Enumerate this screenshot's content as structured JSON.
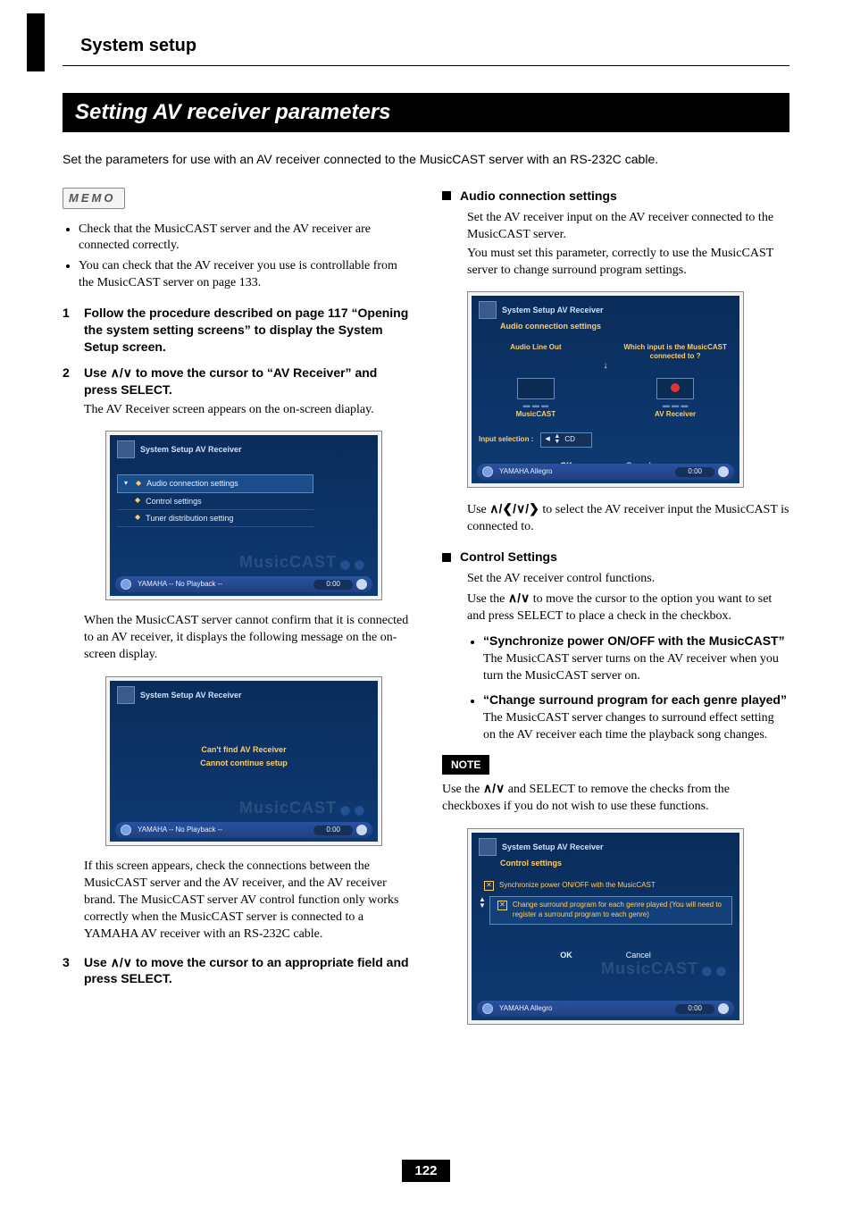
{
  "header": {
    "section": "System setup",
    "title": "Setting AV receiver parameters",
    "intro": "Set the parameters for use with an AV receiver connected to the MusicCAST server with an RS-232C cable."
  },
  "memo": {
    "label": "MEMO",
    "items": [
      "Check that the MusicCAST server and the AV receiver are connected correctly.",
      "You can check that the AV receiver you use is controllable from the MusicCAST server on page 133."
    ]
  },
  "steps": {
    "s1": {
      "num": "1",
      "title": "Follow the procedure described on page 117 “Opening the system setting screens” to display the System Setup screen."
    },
    "s2": {
      "num": "2",
      "title_a": "Use ",
      "title_b": " to move the cursor to “AV Receiver” and press SELECT.",
      "arrows": "∧/∨",
      "desc": "The AV Receiver screen appears on the on-screen diaplay."
    },
    "s3": {
      "num": "3",
      "title_a": "Use ",
      "title_b": " to move the cursor to an appropriate field and press SELECT.",
      "arrows": "∧/∨"
    }
  },
  "screen1": {
    "breadcrumb": "System Setup   AV Receiver",
    "items": [
      "Audio connection settings",
      "Control settings",
      "Tuner distribution setting"
    ],
    "watermark": "MusicCAST",
    "status_left": "YAMAHA  -- No Playback --",
    "status_time": "0:00"
  },
  "between12": "When the MusicCAST server cannot confirm that it is connected to an AV receiver, it displays the following message on the on-screen display.",
  "screen2": {
    "breadcrumb": "System Setup   AV Receiver",
    "msg1": "Can't find AV Receiver",
    "msg2": "Cannot continue setup",
    "watermark": "MusicCAST",
    "status_left": "YAMAHA  -- No Playback --",
    "status_time": "0:00"
  },
  "after2": "If this screen appears, check the connections between the MusicCAST server and the AV receiver, and the AV receiver brand. The MusicCAST server AV control function only works correctly when the MusicCAST server is connected to a YAMAHA AV receiver with an RS-232C cable.",
  "right": {
    "acs": {
      "title": "Audio connection settings",
      "p1": "Set the AV receiver input on the AV receiver connected to the MusicCAST server.",
      "p2": "You must set this parameter, correctly to use the MusicCAST server to change surround program settings.",
      "after_a": "Use ",
      "after_arrows": "∧/❮/∨/❯",
      "after_b": " to select the AV receiver input the MusicCAST is connected to."
    },
    "screen3": {
      "breadcrumb": "System Setup   AV Receiver",
      "subtitle": "Audio connection settings",
      "lineout": "Audio Line Out",
      "question": "Which input is the MusicCAST connected to ?",
      "dev1": "MusicCAST",
      "dev2": "AV Receiver",
      "inputsel": "Input selection :",
      "inputval": "CD",
      "ok": "OK",
      "cancel": "Cancel",
      "status_left": "YAMAHA  Allegro",
      "status_time": "0:00",
      "watermark": "MusicCAST"
    },
    "cs": {
      "title": "Control Settings",
      "p1": "Set the AV receiver control functions.",
      "p2_a": "Use the ",
      "p2_arrows": "∧/∨",
      "p2_b": " to move the cursor to the option you want to set and press SELECT to place a check in the checkbox.",
      "b1_title": "“Synchronize power ON/OFF with the MusicCAST”",
      "b1_body": "The MusicCAST server turns on the AV receiver when you turn the MusicCAST server on.",
      "b2_title": "“Change surround program for each genre played”",
      "b2_body": "The MusicCAST server changes to surround effect setting on the AV receiver each time the playback song changes."
    },
    "note": {
      "label": "NOTE",
      "body_a": "Use the ",
      "body_arrows": "∧/∨",
      "body_b": " and SELECT to remove the checks from the checkboxes if you do not wish to use these functions."
    },
    "screen4": {
      "breadcrumb": "System Setup   AV Receiver",
      "subtitle": "Control settings",
      "row1": "Synchronize power ON/OFF with the MusicCAST",
      "row2": "Change surround program for each genre played (You will need to register a surround program to each genre)",
      "ok": "OK",
      "cancel": "Cancel",
      "status_left": "YAMAHA  Allegro",
      "status_time": "0:00",
      "watermark": "MusicCAST"
    }
  },
  "page_number": "122"
}
